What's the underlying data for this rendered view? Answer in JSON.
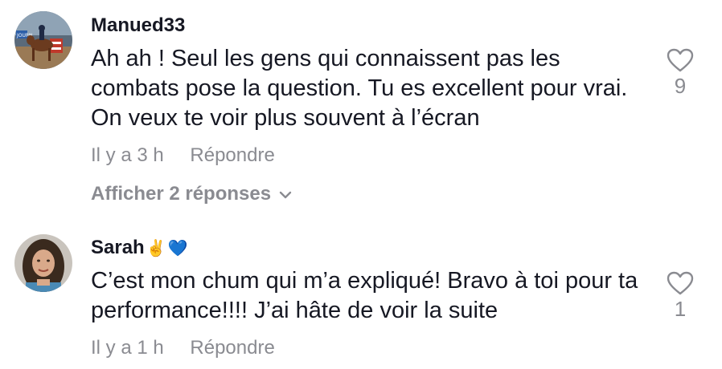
{
  "comments": [
    {
      "username": "Manued33",
      "text": "Ah ah ! Seul les gens qui connaissent pas les combats pose la question. Tu es excellent pour vrai. On veux te voir plus souvent à l’écran",
      "time": "Il y a 3 h",
      "reply_label": "Répondre",
      "likes": "9",
      "view_replies": "Afficher 2 réponses",
      "avatar_icon": "horse-rider-avatar"
    },
    {
      "username": "Sarah",
      "username_emojis": "✌️",
      "heart_emoji": "💙",
      "text": "C’est mon chum qui m’a expliqué! Bravo à toi pour ta performance!!!! J’ai hâte de voir la suite",
      "time": "Il y a 1 h",
      "reply_label": "Répondre",
      "likes": "1",
      "avatar_icon": "woman-portrait-avatar"
    }
  ],
  "colors": {
    "text": "#161823",
    "muted": "#8a8b91",
    "heart_blue": "#2b8af7"
  }
}
